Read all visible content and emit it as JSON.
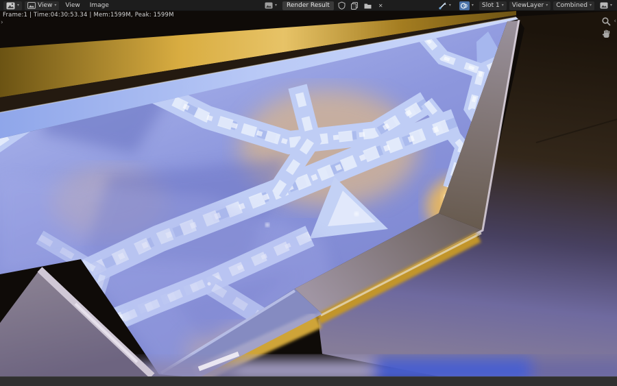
{
  "header": {
    "mode_label": "View",
    "menu_view": "View",
    "menu_image": "Image",
    "image_name": "Render Result",
    "slot": "Slot 1",
    "view_layer": "ViewLayer",
    "render_pass": "Combined",
    "chevron": "▾",
    "close_glyph": "✕"
  },
  "render_info": "Frame:1 | Time:04:30:53.34 | Mem:1599M, Peak: 1599M",
  "viewport": {
    "toolbar_toggle": "›",
    "sidebar_toggle": "‹"
  },
  "colors": {
    "header_bg": "#1d1d1d",
    "statusbar_bg": "#303030",
    "toggle_accent_blue": "#4b72a8",
    "render_gold": "#d9ad41",
    "render_periwinkle": "#8d97dd",
    "render_ice": "#c3d1f5",
    "render_wall_brown": "#33271a",
    "render_floor_purple": "#6c6aa5"
  }
}
